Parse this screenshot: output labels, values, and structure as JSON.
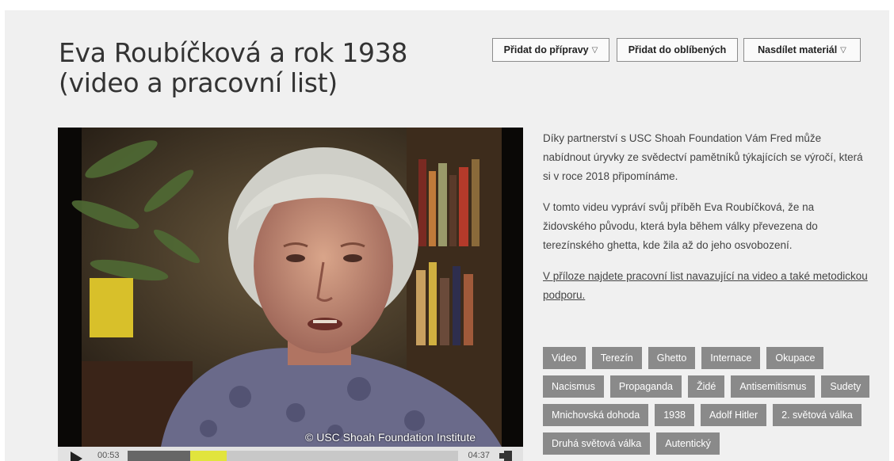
{
  "page": {
    "title": "Eva Roubíčková a rok 1938 (video a pracovní list)"
  },
  "actions": {
    "add_to_prep": "Přidat do přípravy",
    "add_to_favorites": "Přidat do oblíbených",
    "share": "Nasdílet materiál"
  },
  "video": {
    "watermark": "© USC Shoah Foundation Institute",
    "current_time": "00:53",
    "total_time": "04:37",
    "progress_fraction": 0.19,
    "buffered_fraction": 0.21,
    "accent_color": "#e1e43d"
  },
  "description": {
    "p1": "Díky partnerství s USC Shoah Foundation Vám Fred může nabídnout úryvky ze svědectví pamětníků týkajících se výročí, která si v roce 2018 připomínáme.",
    "p2": "V tomto videu vypráví svůj příběh Eva Roubíčková, že na židovského původu, která byla během války převezena do terezínského ghetta, kde žila až do jeho osvobození.",
    "link": "V příloze najdete pracovní list navazující na video a také metodickou podporu."
  },
  "tags": [
    "Video",
    "Terezín",
    "Ghetto",
    "Internace",
    "Okupace",
    "Nacismus",
    "Propaganda",
    "Židé",
    "Antisemitismus",
    "Sudety",
    "Mnichovská dohoda",
    "1938",
    "Adolf Hitler",
    "2. světová válka",
    "Druhá světová válka",
    "Autentický"
  ],
  "colors": {
    "panel_bg": "#f0f0f0",
    "tag_bg": "#8a8a8a"
  }
}
